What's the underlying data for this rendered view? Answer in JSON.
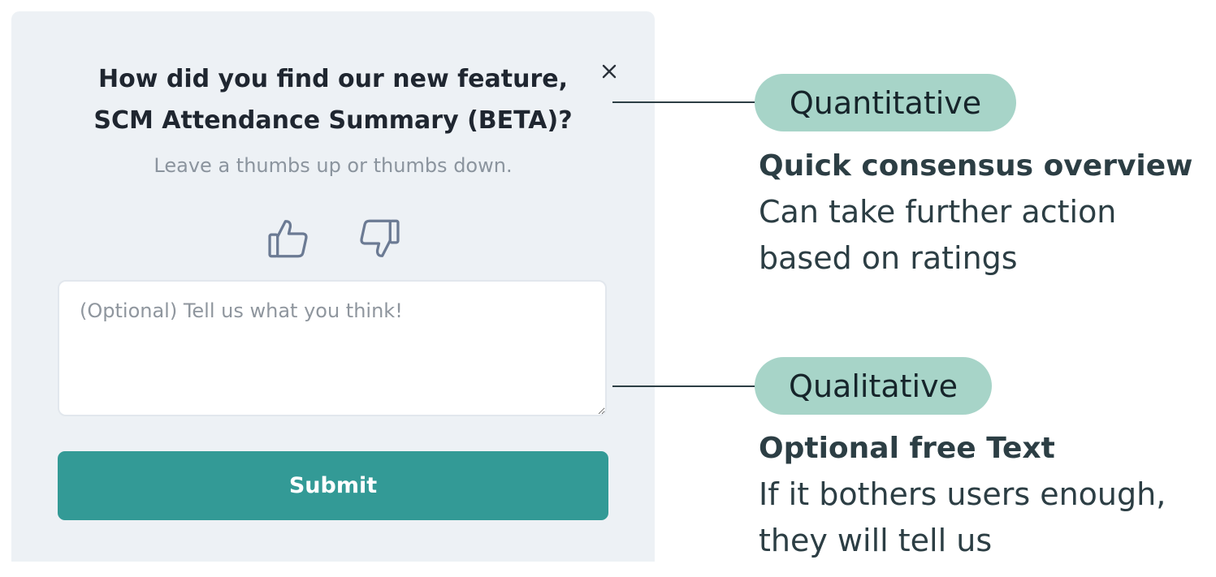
{
  "card": {
    "title_line1": "How did you find our new feature,",
    "title_line2": "SCM Attendance Summary (BETA)?",
    "subtitle": "Leave a thumbs up or thumbs down.",
    "close_icon": "close-icon",
    "thumbs_up_icon": "thumbs-up-icon",
    "thumbs_down_icon": "thumbs-down-icon",
    "feedback_placeholder": "(Optional) Tell us what you think!",
    "feedback_value": "",
    "submit_label": "Submit"
  },
  "annotations": {
    "quantitative": {
      "pill_label": "Quantitative",
      "heading": "Quick consensus overview",
      "line1": "Can take further action",
      "line2": "based on ratings"
    },
    "qualitative": {
      "pill_label": "Qualitative",
      "heading": "Optional free Text",
      "line1": "If it bothers users enough,",
      "line2": "they will tell us"
    }
  },
  "colors": {
    "card_background": "#edf1f5",
    "accent_button": "#339a96",
    "pill_background": "#a7d4c8",
    "annotation_text": "#2c3e44",
    "icon_stroke": "#6b7a93"
  }
}
